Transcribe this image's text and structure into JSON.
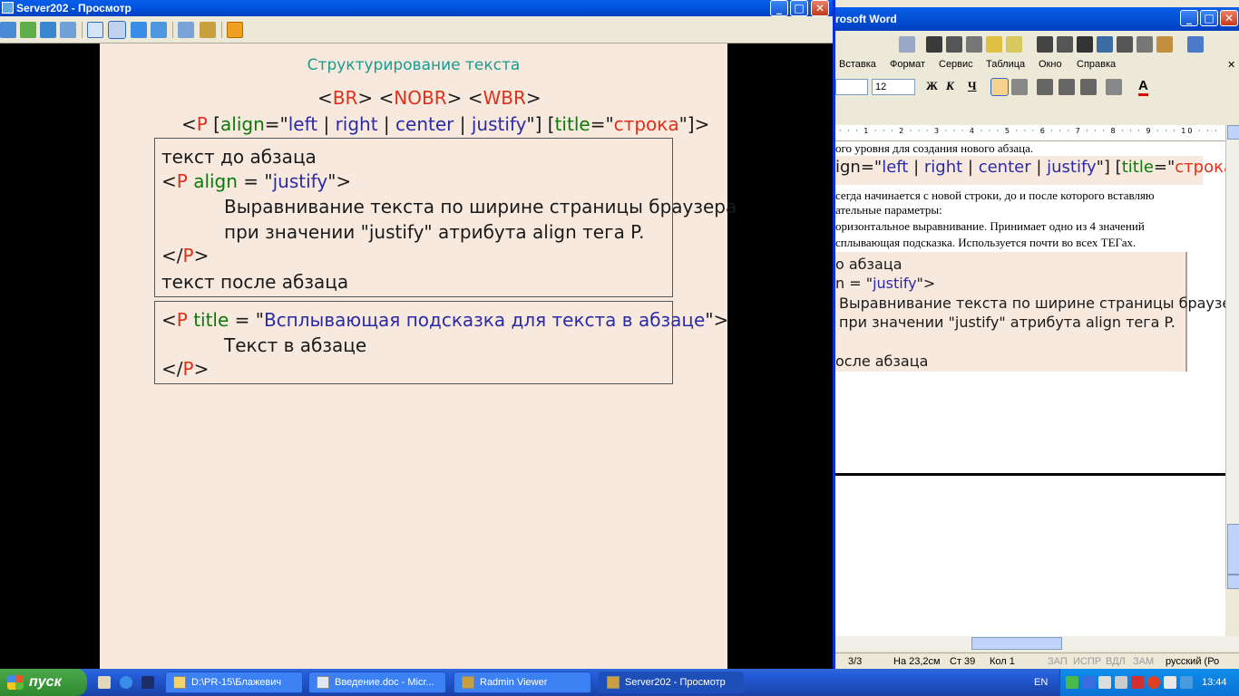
{
  "viewer": {
    "title": "Server202 - Просмотр",
    "slide": {
      "title": "Структурирование текста",
      "line1": [
        "<",
        "BR",
        "> <",
        "NOBR",
        "> <",
        "WBR",
        ">"
      ],
      "line2": [
        "<",
        "P",
        " [",
        "align",
        "=\"",
        "left",
        " | ",
        "right",
        " | ",
        "center",
        " | ",
        "justify",
        "\"] [",
        "title",
        "=\"",
        "строка",
        "\"]>"
      ],
      "box1": {
        "before": "текст до абзаца",
        "open": [
          "<",
          "P",
          " ",
          "align",
          " = \"",
          "justify",
          "\">"
        ],
        "body1": "Выравнивание текста по ширине страницы браузера",
        "body2": "при значении \"justify\" атрибута align тега P.",
        "close": [
          "</",
          "P",
          ">"
        ],
        "after": "текст после абзаца"
      },
      "box2": {
        "open": [
          "<",
          "P",
          " ",
          "title",
          " = \"",
          "Всплывающая подсказка для текста в абзаце",
          "\">"
        ],
        "body": "Текст в абзаце",
        "close": [
          "</",
          "P",
          ">"
        ]
      }
    }
  },
  "word": {
    "title": "rosoft Word",
    "menu": [
      "Вставка",
      "Формат",
      "Сервис",
      "Таблица",
      "Окно",
      "Справка"
    ],
    "font_size": "12",
    "doc": {
      "l1": "ого уровня для создания нового абзаца.",
      "l2": [
        "ign=\"",
        "left",
        " | ",
        "right",
        " | ",
        "center",
        " | ",
        "justify",
        "\"] [",
        "title",
        "=\"",
        "строка",
        "\"]>"
      ],
      "l3": "сегда начинается с новой строки, до и после которого вставляю",
      "l4": "ательные параметры:",
      "l5": "оризонтальное выравнивание. Принимает одно из 4 значений",
      "l6": "сплывающая подсказка. Используется почти во всех ТЕГах.",
      "l7": "о абзаца",
      "l8": [
        "n = \"",
        "justify",
        "\">"
      ],
      "l9": "Выравнивание текста по ширине страницы браузера",
      "l10": "при значении \"justify\" атрибута align тега P.",
      "l11": "осле абзаца"
    },
    "status": {
      "page": "3/3",
      "at": "На 23,2см",
      "line": "Ст 39",
      "col": "Кол 1",
      "rec": "ЗАП",
      "trk": "ИСПР",
      "ext": "ВДЛ",
      "ovr": "ЗАМ",
      "lang": "русский (Ро"
    }
  },
  "taskbar": {
    "start": "пуск",
    "tasks": [
      "D:\\PR-15\\Блажевич",
      "Введение.doc - Micr...",
      "Radmin Viewer",
      "Server202 - Просмотр"
    ],
    "lang": "EN",
    "clock": "13:44"
  }
}
